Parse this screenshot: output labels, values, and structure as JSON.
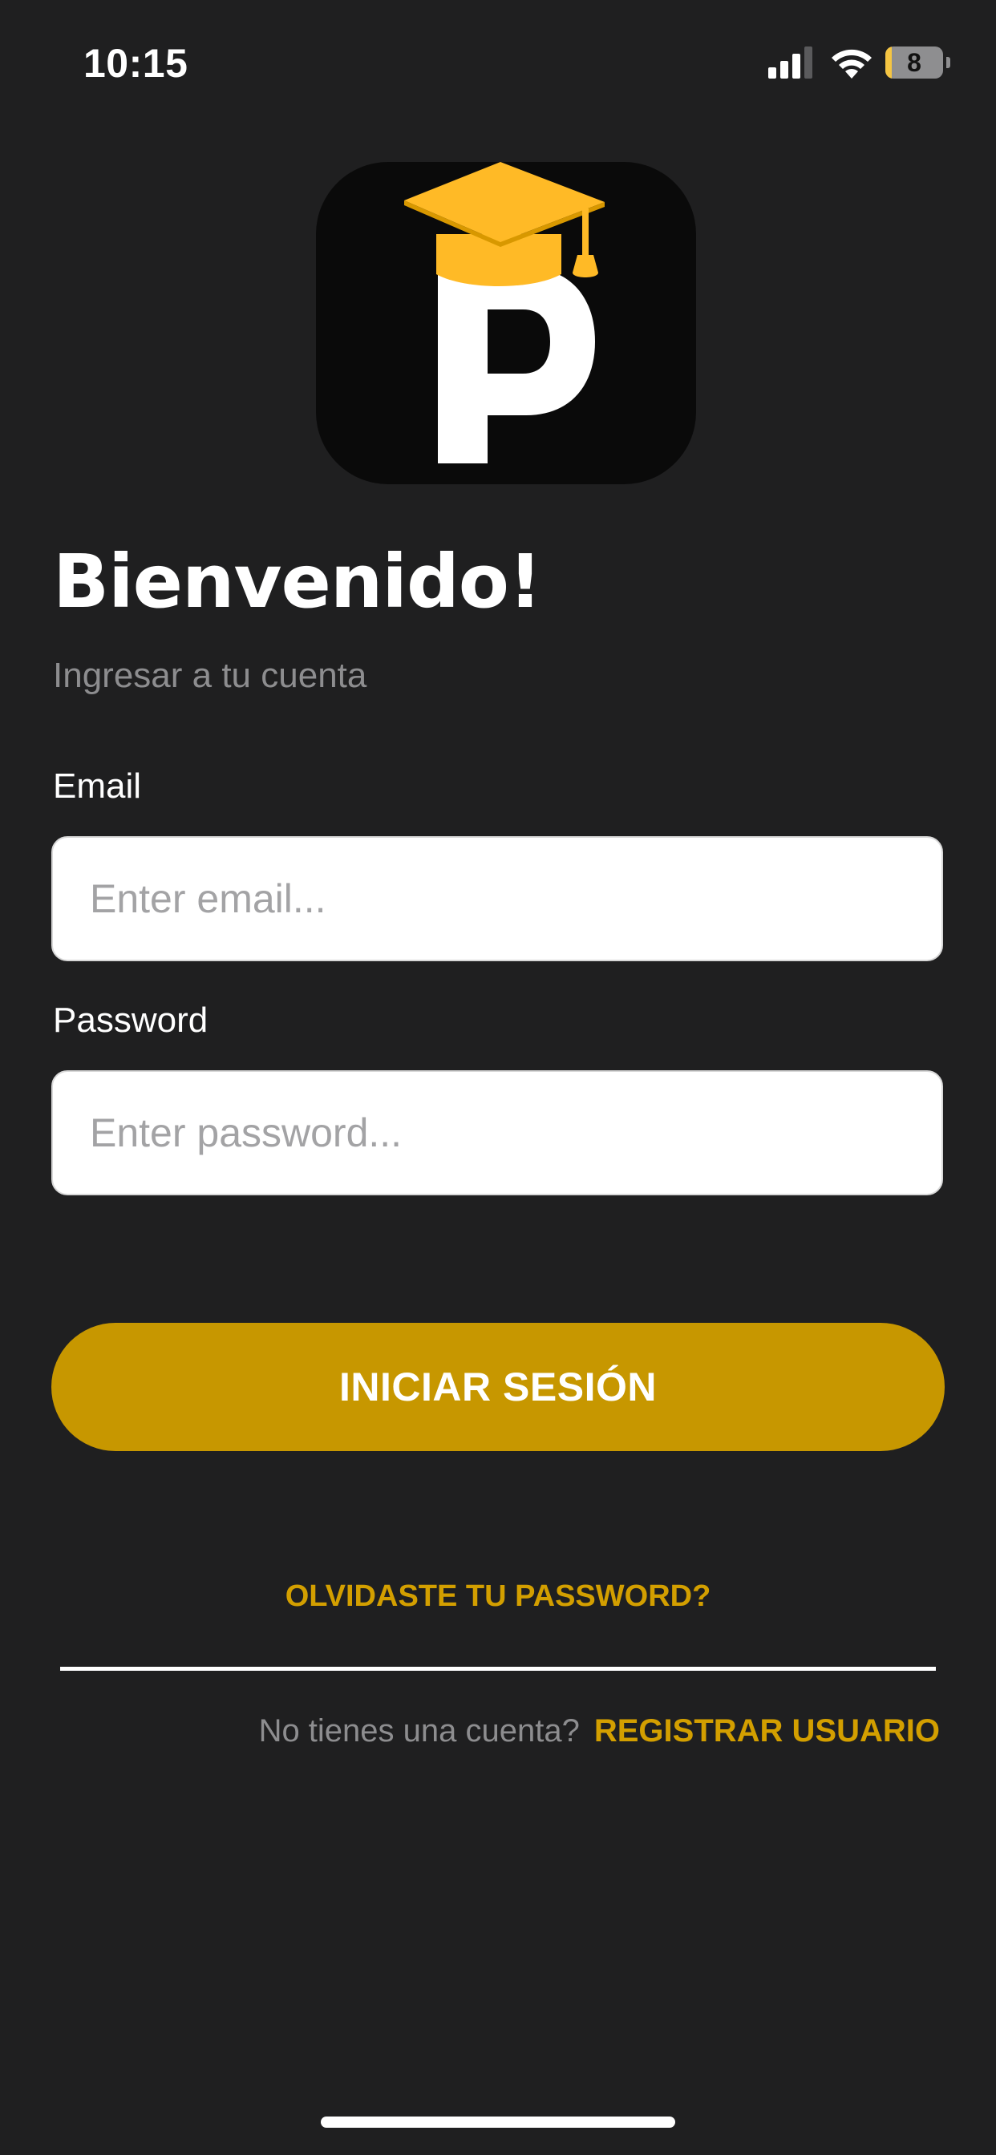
{
  "status_bar": {
    "time": "10:15",
    "battery_level": "8",
    "battery_fraction": 0.08,
    "signal_bars": 3,
    "signal_icon": "cellular-signal-icon",
    "wifi_icon": "wifi-icon",
    "battery_icon": "battery-icon"
  },
  "logo": {
    "icon": "graduation-cap-p-logo",
    "letter": "P"
  },
  "header": {
    "title": "Bienvenido!",
    "subtitle": "Ingresar a tu cuenta"
  },
  "form": {
    "email_label": "Email",
    "email_placeholder": "Enter email...",
    "email_value": "",
    "password_label": "Password",
    "password_placeholder": "Enter password...",
    "password_value": "",
    "login_label": "INICIAR SESIÓN",
    "forgot_label": "OLVIDASTE TU PASSWORD?"
  },
  "register": {
    "question": "No tienes una cuenta?",
    "link_label": "REGISTRAR USUARIO"
  },
  "colors": {
    "background": "#1f1f20",
    "accent": "#c79700",
    "link": "#d39f00",
    "logo_cap": "#ffba26"
  }
}
